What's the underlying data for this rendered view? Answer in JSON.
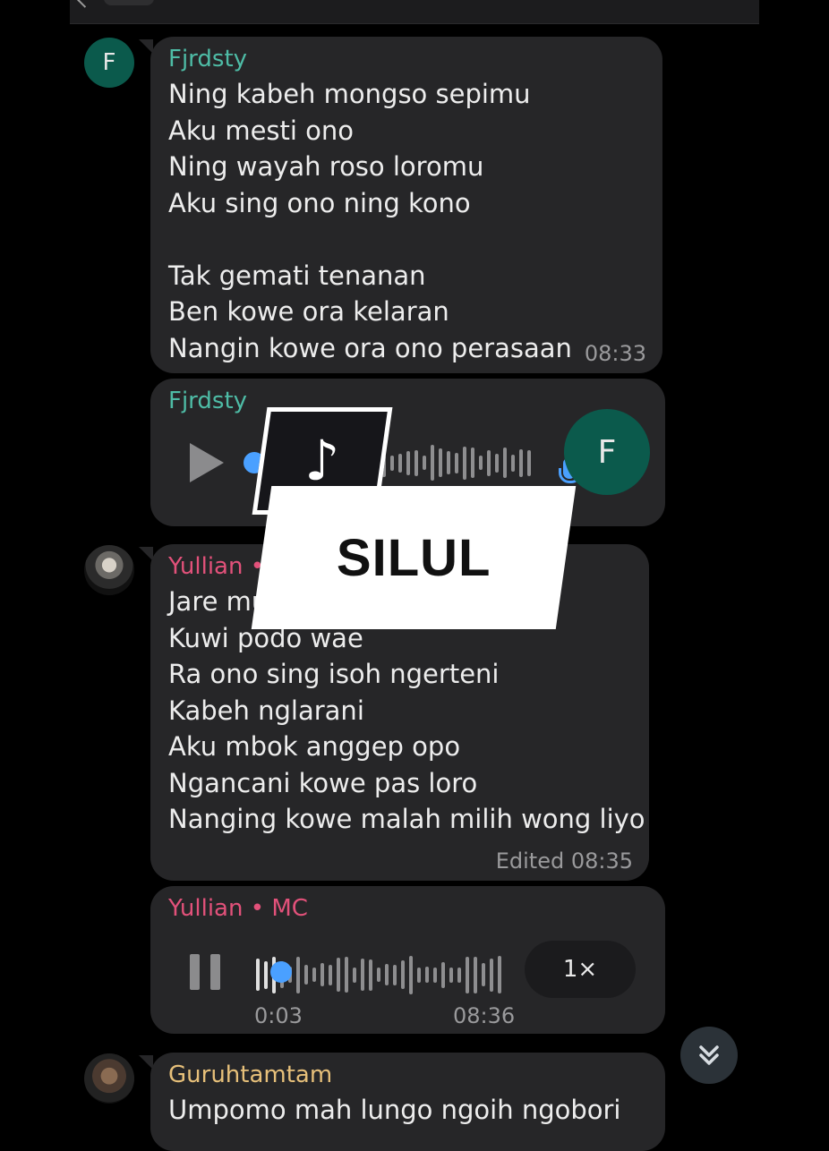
{
  "colors": {
    "background": "#000000",
    "bubble": "#262628",
    "green_name": "#4ebca6",
    "pink_name": "#e2517a",
    "yellow_name": "#e7c07a",
    "accent": "#4aa0ff",
    "avatar_f": "#0b5a4c"
  },
  "messages": [
    {
      "sender": "Fjrdsty",
      "avatar_letter": "F",
      "lines": "Ning kabeh mongso sepimu\nAku mesti ono\nNing wayah roso loromu\nAku sing ono ning kono\n\nTak gemati tenanan\nBen kowe ora kelaran\nNangin kowe ora ono perasaan",
      "time": "08:33"
    },
    {
      "sender": "Fjrdsty",
      "type": "voice",
      "avatar_letter": "F",
      "icon": "mic-icon"
    },
    {
      "sender": "Yullian •",
      "lines": "Jare mu\nKuwi podo wae\nRa ono sing isoh ngerteni\nKabeh nglarani\nAku mbok anggep opo\nNgancani kowe pas loro\nNanging kowe malah milih wong liyo",
      "time": "Edited 08:35"
    },
    {
      "sender": "Yullian • MC",
      "type": "voice",
      "elapsed": "0:03",
      "time": "08:36",
      "speed": "1×",
      "progress": 0.1
    },
    {
      "sender": "Guruhtamtam",
      "lines": "Umpomo mah lungo ngoih ngobori"
    }
  ],
  "overlay": {
    "app_icon": "tiktok-icon",
    "username": "SILUL"
  },
  "scroll_button_icon": "double-chevron-down-icon"
}
